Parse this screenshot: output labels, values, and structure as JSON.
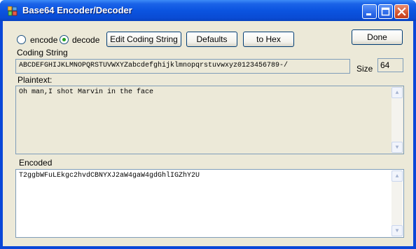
{
  "window": {
    "title": "Base64 Encoder/Decoder"
  },
  "mode": {
    "encode_label": "encode",
    "decode_label": "decode",
    "selected": "decode"
  },
  "toolbar": {
    "edit_coding_string_label": "Edit Coding String",
    "defaults_label": "Defaults",
    "to_hex_label": "to Hex",
    "done_label": "Done"
  },
  "coding_string": {
    "label": "Coding String",
    "value": "ABCDEFGHIJKLMNOPQRSTUVWXYZabcdefghijklmnopqrstuvwxyz0123456789-/",
    "size_label": "Size",
    "size_value": "64"
  },
  "plaintext": {
    "label": "Plaintext:",
    "value": "Oh man,I shot Marvin in the face"
  },
  "encoded": {
    "label": "Encoded",
    "value": "T2ggbWFuLEkgc2hvdCBNYXJ2aW4gaW4gdGhlIGZhY2U"
  },
  "colors": {
    "titlebar": "#0b54e0",
    "client_bg": "#ece9d8",
    "field_border": "#7f9db9"
  }
}
